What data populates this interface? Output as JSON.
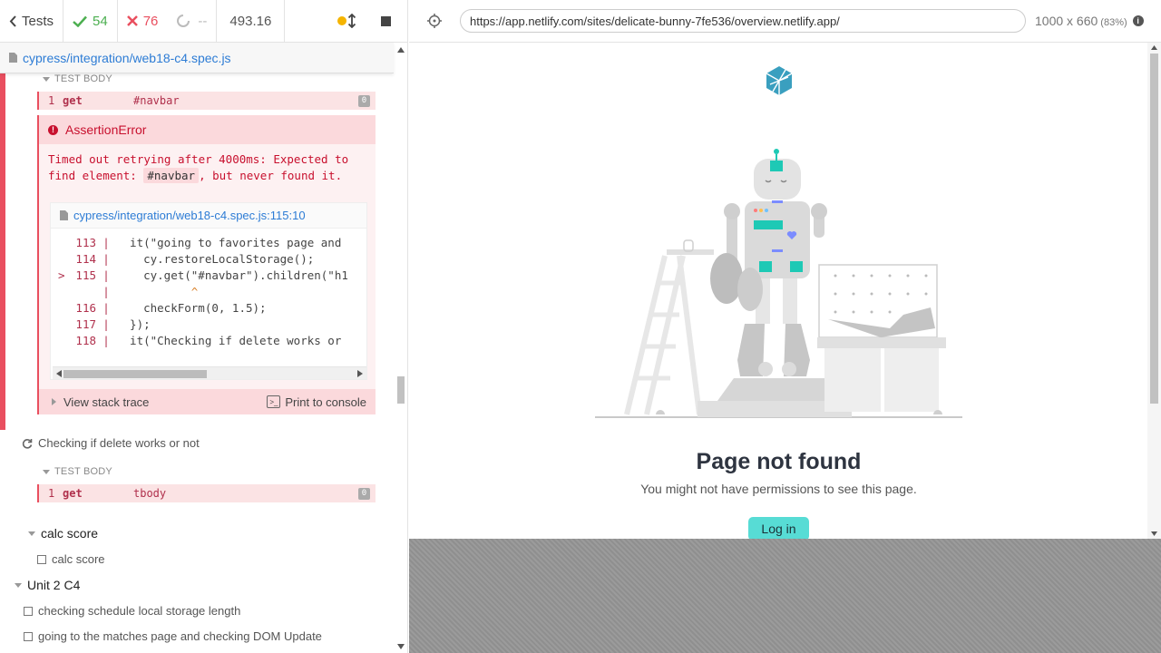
{
  "header": {
    "tests_label": "Tests",
    "passed_count": "54",
    "failed_count": "76",
    "pending_count": "--",
    "duration": "493.16"
  },
  "runnable": {
    "spec_file": "cypress/integration/web18-c4.spec.js"
  },
  "failed_test": {
    "hook_label": "TEST BODY",
    "command": {
      "num": "1",
      "name": "get",
      "selector": "#navbar",
      "badge": "0"
    },
    "error": {
      "title": "AssertionError",
      "message_part1": "Timed out retrying after 4000ms: Expected to find element:",
      "message_code": "#navbar",
      "message_part2": ", but never found it.",
      "code_file": "cypress/integration/web18-c4.spec.js:115:10",
      "code_lines": [
        {
          "marker": "",
          "num": "113",
          "src": "  it(\"going to favorites page and"
        },
        {
          "marker": "",
          "num": "114",
          "src": "    cy.restoreLocalStorage();"
        },
        {
          "marker": ">",
          "num": "115",
          "src": "    cy.get(\"#navbar\").children(\"h1"
        },
        {
          "marker": "",
          "num": "",
          "src": "           ^"
        },
        {
          "marker": "",
          "num": "116",
          "src": "    checkForm(0, 1.5);"
        },
        {
          "marker": "",
          "num": "117",
          "src": "  });"
        },
        {
          "marker": "",
          "num": "118",
          "src": "  it(\"Checking if delete works or"
        }
      ],
      "stack_label": "View stack trace",
      "print_label": "Print to console"
    }
  },
  "running_test": {
    "title": "Checking if delete works or not",
    "hook_label": "TEST BODY",
    "command": {
      "num": "1",
      "name": "get",
      "selector": "tbody",
      "badge": "0"
    }
  },
  "suites": [
    {
      "title": "calc score",
      "tests": [
        "calc score"
      ]
    },
    {
      "title": "Unit 2 C4",
      "tests": [
        "checking schedule local storage length",
        "going to the matches page and checking DOM Update"
      ]
    }
  ],
  "aut": {
    "url": "https://app.netlify.com/sites/delicate-bunny-7fe536/overview.netlify.app/",
    "viewport": "1000 x 660",
    "scale": "(83%)",
    "page_title": "Page not found",
    "page_subtitle": "You might not have permissions to see this page.",
    "login_label": "Log in"
  },
  "colors": {
    "pass": "#4caf50",
    "fail": "#e94f5f",
    "link": "#2d7cd5",
    "accent_teal": "#57dcd5"
  }
}
